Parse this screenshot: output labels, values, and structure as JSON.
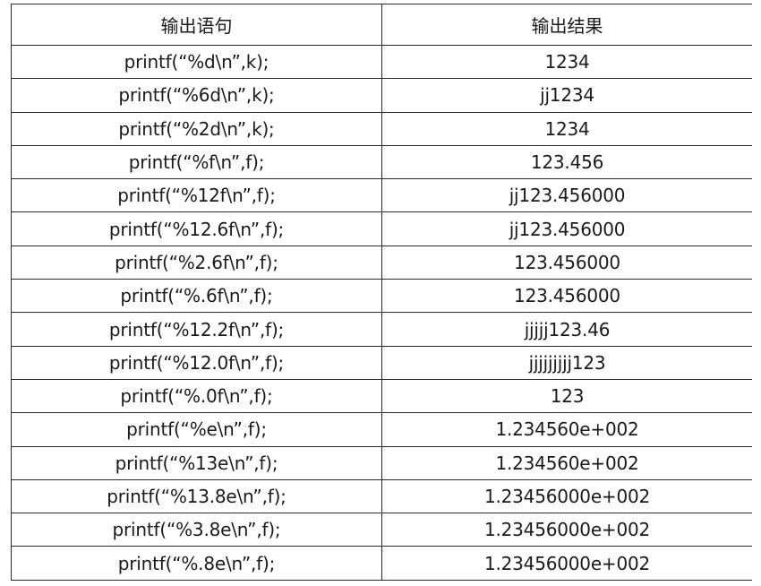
{
  "table": {
    "headers": [
      "输出语句",
      "输出结果"
    ],
    "rows": [
      [
        "printf(“%d\\n”,k);",
        "1234"
      ],
      [
        "printf(“%6d\\n”,k);",
        "jj1234"
      ],
      [
        "printf(“%2d\\n”,k);",
        "1234"
      ],
      [
        "printf(“%f\\n”,f);",
        "123.456"
      ],
      [
        "printf(“%12f\\n”,f);",
        "jj123.456000"
      ],
      [
        "printf(“%12.6f\\n”,f);",
        "jj123.456000"
      ],
      [
        "printf(“%2.6f\\n”,f);",
        "123.456000"
      ],
      [
        "printf(“%.6f\\n”,f);",
        "123.456000"
      ],
      [
        "printf(“%12.2f\\n”,f);",
        "jjjjj123.46"
      ],
      [
        "printf(“%12.0f\\n”,f);",
        "jjjjjjjjj123"
      ],
      [
        "printf(“%.0f\\n”,f);",
        "123"
      ],
      [
        "printf(“%e\\n”,f);",
        "1.234560e+002"
      ],
      [
        "printf(“%13e\\n”,f);",
        "1.234560e+002"
      ],
      [
        "printf(“%13.8e\\n”,f);",
        "1.23456000e+002"
      ],
      [
        "printf(“%3.8e\\n”,f);",
        "1.23456000e+002"
      ],
      [
        "printf(“%.8e\\n”,f);",
        "1.23456000e+002"
      ]
    ]
  }
}
